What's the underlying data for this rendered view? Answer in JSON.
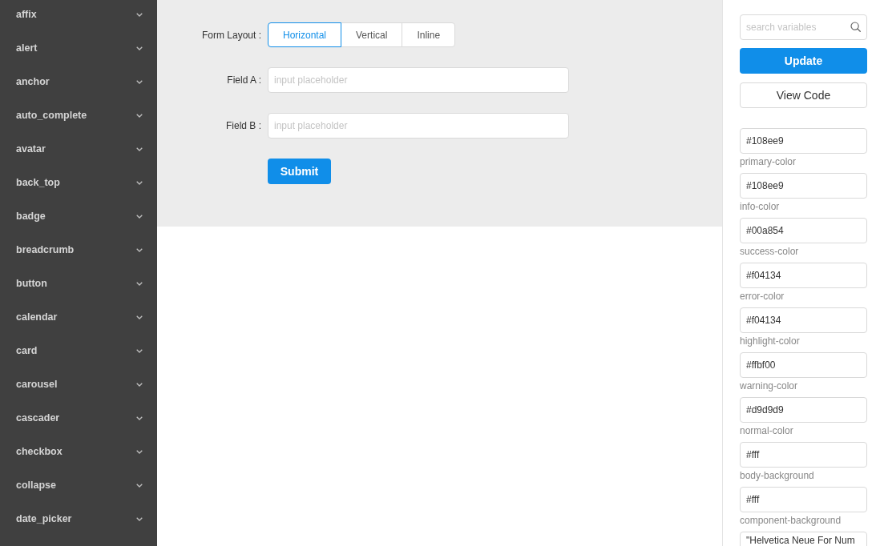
{
  "sidebar": {
    "items": [
      {
        "label": "affix",
        "expanded": false
      },
      {
        "label": "alert",
        "expanded": false
      },
      {
        "label": "anchor",
        "expanded": false
      },
      {
        "label": "auto_complete",
        "expanded": false
      },
      {
        "label": "avatar",
        "expanded": false
      },
      {
        "label": "back_top",
        "expanded": false
      },
      {
        "label": "badge",
        "expanded": false
      },
      {
        "label": "breadcrumb",
        "expanded": false
      },
      {
        "label": "button",
        "expanded": false
      },
      {
        "label": "calendar",
        "expanded": false
      },
      {
        "label": "card",
        "expanded": false
      },
      {
        "label": "carousel",
        "expanded": false
      },
      {
        "label": "cascader",
        "expanded": false
      },
      {
        "label": "checkbox",
        "expanded": false
      },
      {
        "label": "collapse",
        "expanded": false
      },
      {
        "label": "date_picker",
        "expanded": false
      }
    ]
  },
  "form": {
    "layout_label": "Form Layout :",
    "layout_options": [
      {
        "label": "Horizontal",
        "selected": true
      },
      {
        "label": "Vertical",
        "selected": false
      },
      {
        "label": "Inline",
        "selected": false
      }
    ],
    "fields": [
      {
        "label": "Field A :",
        "placeholder": "input placeholder"
      },
      {
        "label": "Field B :",
        "placeholder": "input placeholder"
      }
    ],
    "submit": "Submit"
  },
  "variables_panel": {
    "search": {
      "placeholder": "search variables"
    },
    "buttons": [
      {
        "label": "Update",
        "kind": "primary"
      },
      {
        "label": "View Code",
        "kind": "default"
      }
    ],
    "variables": [
      {
        "value": "#108ee9",
        "name": "primary-color"
      },
      {
        "value": "#108ee9",
        "name": "info-color"
      },
      {
        "value": "#00a854",
        "name": "success-color"
      },
      {
        "value": "#f04134",
        "name": "error-color"
      },
      {
        "value": "#f04134",
        "name": "highlight-color"
      },
      {
        "value": "#ffbf00",
        "name": "warning-color"
      },
      {
        "value": "#d9d9d9",
        "name": "normal-color"
      },
      {
        "value": "#fff",
        "name": "body-background"
      },
      {
        "value": "#fff",
        "name": "component-background"
      },
      {
        "value": "\"Helvetica Neue For Num"
      }
    ]
  }
}
